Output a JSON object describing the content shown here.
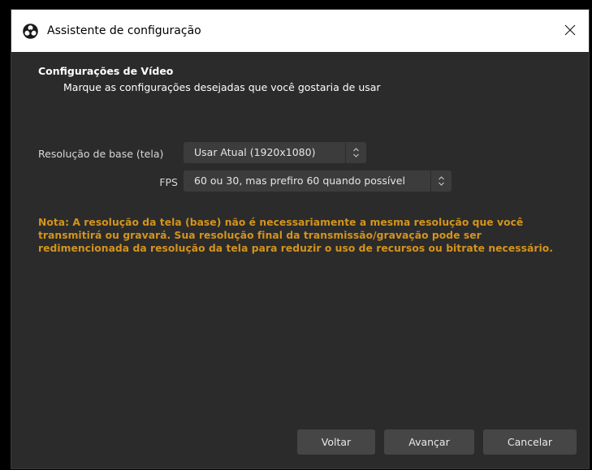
{
  "window": {
    "title": "Assistente de configuração"
  },
  "section": {
    "title": "Configurações de Vídeo",
    "subtitle": "Marque as configurações desejadas que você gostaria de usar"
  },
  "form": {
    "resolution_label": "Resolução de base (tela)",
    "resolution_value": "Usar Atual (1920x1080)",
    "fps_label": "FPS",
    "fps_value": "60 ou 30, mas prefiro 60 quando possível"
  },
  "note": "Nota: A resolução da tela (base) não é necessariamente a mesma resolução que você transmitirá ou gravará. Sua resolução final da transmissão/gravação pode ser redimencionada da resolução da tela para reduzir o uso de recursos ou bitrate necessário.",
  "buttons": {
    "back": "Voltar",
    "next": "Avançar",
    "cancel": "Cancelar"
  },
  "colors": {
    "background": "#2b2b2b",
    "note_text": "#d4941c",
    "button_bg": "#464646",
    "select_bg": "#3c3c3c"
  },
  "icons": {
    "app": "obs-logo-icon",
    "close": "close-icon",
    "spin": "up-down-chevron-icon"
  }
}
